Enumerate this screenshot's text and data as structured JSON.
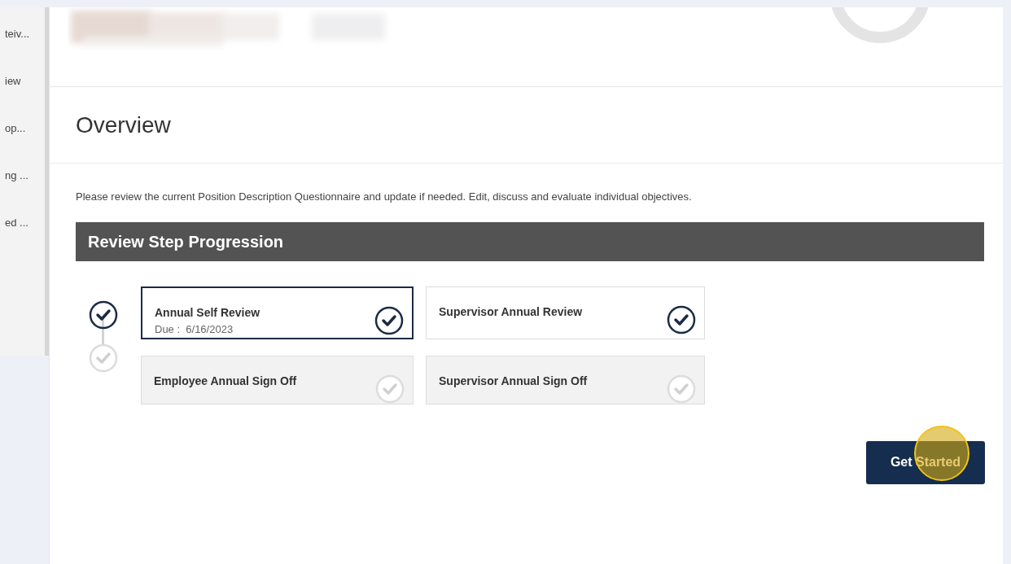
{
  "sidebar": {
    "items": [
      {
        "label": "teiv..."
      },
      {
        "label": "iew"
      },
      {
        "label": "op..."
      },
      {
        "label": "ng ..."
      },
      {
        "label": "ed ..."
      }
    ]
  },
  "overview": {
    "title": "Overview",
    "description": "Please review the current Position Description Questionnaire and update if needed. Edit, discuss and evaluate individual objectives."
  },
  "progression": {
    "title": "Review Step Progression",
    "timeline": [
      {
        "completed": true
      },
      {
        "completed": false
      }
    ],
    "steps": [
      {
        "title": "Annual Self Review",
        "due": "Due :  6/16/2023",
        "completed": true,
        "selected": true
      },
      {
        "title": "Supervisor Annual Review",
        "completed": true,
        "selected": false
      },
      {
        "title": "Employee Annual Sign Off",
        "completed": false,
        "selected": false
      },
      {
        "title": "Supervisor Annual Sign Off",
        "completed": false,
        "selected": false
      }
    ]
  },
  "button": {
    "label": "Get Started"
  }
}
